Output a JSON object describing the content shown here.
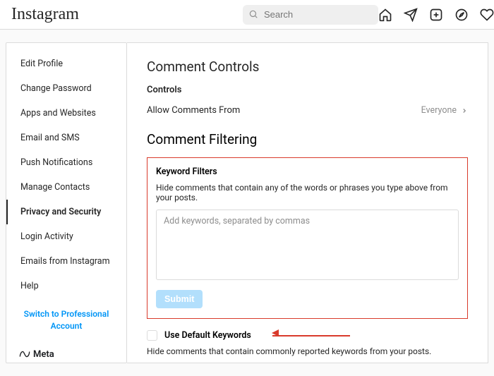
{
  "header": {
    "logo_text": "Instagram",
    "search_placeholder": "Search"
  },
  "sidebar": {
    "items": [
      {
        "label": "Edit Profile"
      },
      {
        "label": "Change Password"
      },
      {
        "label": "Apps and Websites"
      },
      {
        "label": "Email and SMS"
      },
      {
        "label": "Push Notifications"
      },
      {
        "label": "Manage Contacts"
      },
      {
        "label": "Privacy and Security"
      },
      {
        "label": "Login Activity"
      },
      {
        "label": "Emails from Instagram"
      },
      {
        "label": "Help"
      }
    ],
    "switch_label": "Switch to Professional Account",
    "meta_label": "Meta"
  },
  "content": {
    "title": "Comment Controls",
    "controls_heading": "Controls",
    "allow_label": "Allow Comments From",
    "allow_value": "Everyone",
    "filtering_title": "Comment Filtering",
    "keyword_filters": {
      "heading": "Keyword Filters",
      "description": "Hide comments that contain any of the words or phrases you type above from your posts.",
      "placeholder": "Add keywords, separated by commas",
      "submit_label": "Submit"
    },
    "default_keywords": {
      "label": "Use Default Keywords",
      "description": "Hide comments that contain commonly reported keywords from your posts."
    }
  }
}
